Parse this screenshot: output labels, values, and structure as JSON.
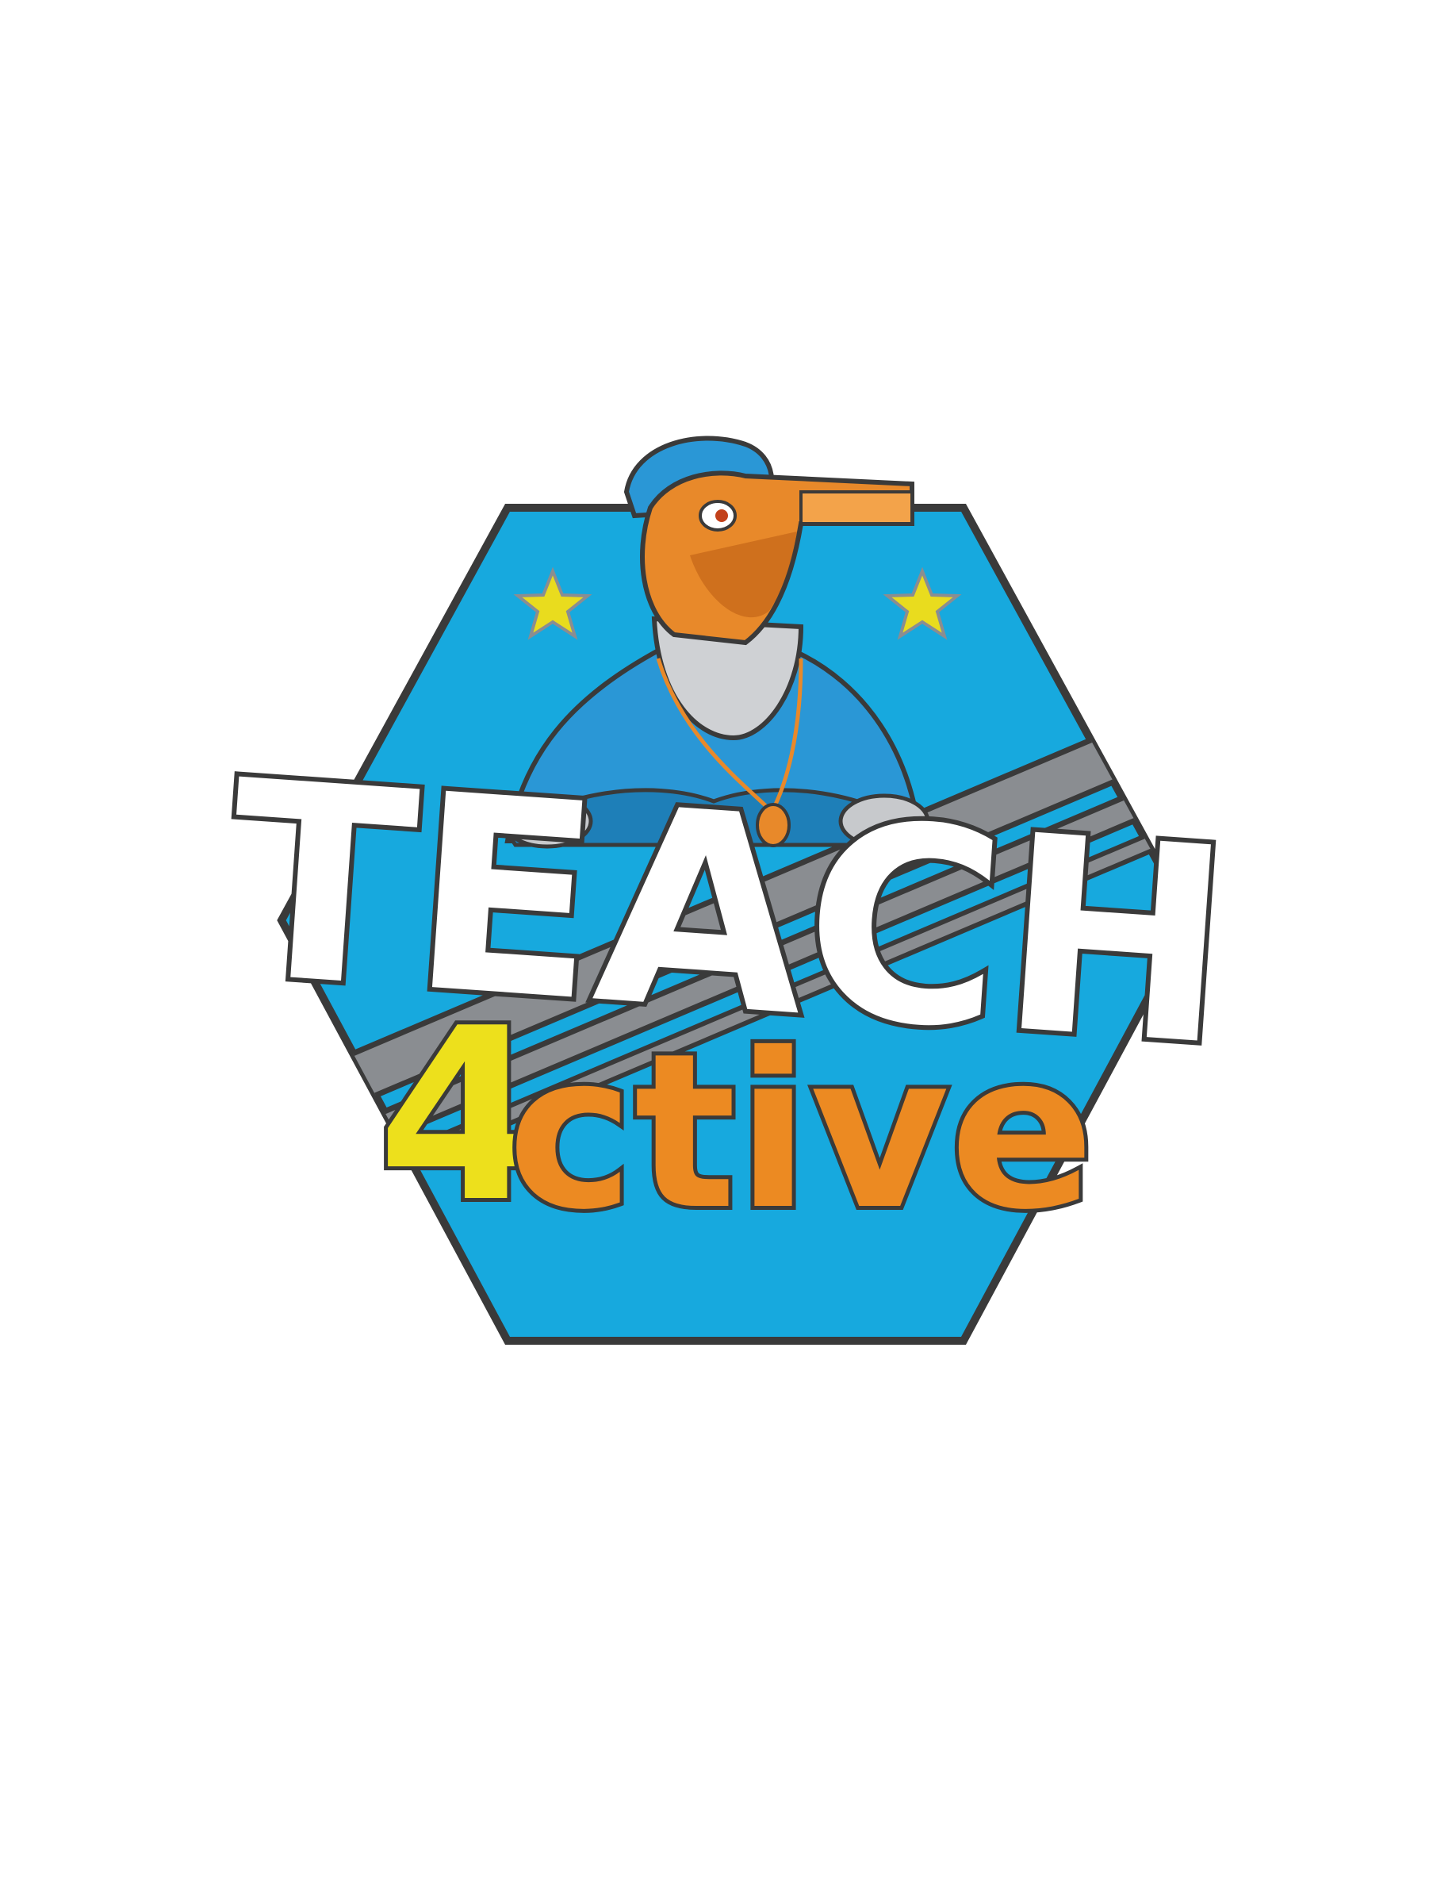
{
  "logo": {
    "word_top": "TEACH",
    "digit": "4",
    "word_bottom": "ctive",
    "mascot": "whistle-headed-coach-mascot",
    "star_icon": "star-icon",
    "colors": {
      "background": "#ffffff",
      "hexagon_fill": "#17a9de",
      "hexagon_outline": "#3a3a3a",
      "stripe": "#8a8d91",
      "star": "#e9dc1e",
      "whistle": "#e8892a",
      "shirt": "#2a97d6",
      "word_top": "#ffffff",
      "digit": "#ede01c",
      "word_bottom": "#ec8a22"
    }
  }
}
